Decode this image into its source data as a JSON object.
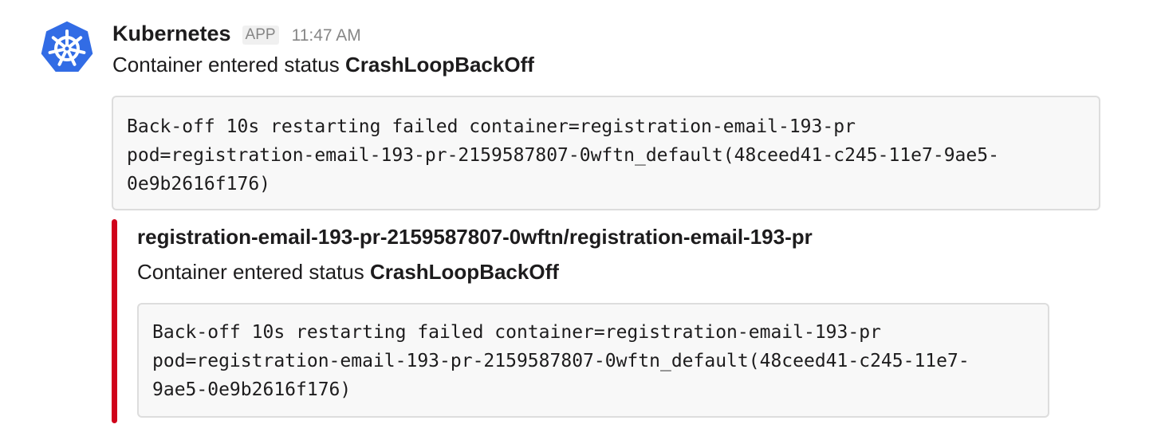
{
  "message": {
    "sender_name": "Kubernetes",
    "app_badge": "APP",
    "timestamp": "11:47 AM",
    "text_prefix": "Container entered status ",
    "text_status": "CrashLoopBackOff",
    "avatar_icon": "kubernetes-helm-icon",
    "avatar_color": "#326ce5",
    "code_lines": [
      "Back-off 10s restarting failed container=registration-email-193-pr",
      "pod=registration-email-193-pr-2159587807-0wftn_default(48ceed41-c245-11e7-9ae5-",
      "0e9b2616f176)"
    ]
  },
  "attachment": {
    "bar_color": "#d0021b",
    "title": "registration-email-193-pr-2159587807-0wftn/registration-email-193-pr",
    "text_prefix": "Container entered status ",
    "text_status": "CrashLoopBackOff",
    "code_lines": [
      "Back-off 10s restarting failed container=registration-email-193-pr",
      "pod=registration-email-193-pr-2159587807-0wftn_default(48ceed41-c245-11e7-",
      "9ae5-0e9b2616f176)"
    ]
  }
}
